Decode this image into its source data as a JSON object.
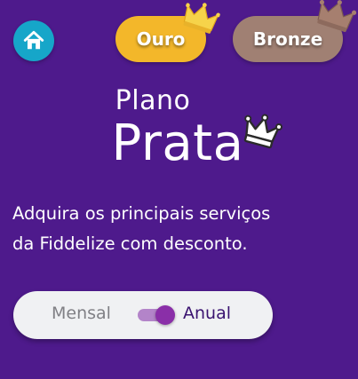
{
  "nav": {
    "home_icon": "home-icon"
  },
  "plans": {
    "ouro_label": "Ouro",
    "bronze_label": "Bronze",
    "crown_icon": "crown-icon"
  },
  "hero": {
    "title_small": "Plano",
    "title_big": "Prata",
    "subtitle_line1": "Adquira os principais serviços",
    "subtitle_line2": "da Fiddelize com desconto."
  },
  "billing": {
    "monthly_label": "Mensal",
    "annual_label": "Anual",
    "selected": "Anual"
  },
  "colors": {
    "background": "#4e1a8c",
    "home_button": "#16a6c9",
    "ouro": "#f3b72a",
    "bronze": "#a08073",
    "toggle_bg": "#f0f1f3",
    "toggle_knob": "#8a2fa8",
    "annual_text": "#3a1370"
  }
}
